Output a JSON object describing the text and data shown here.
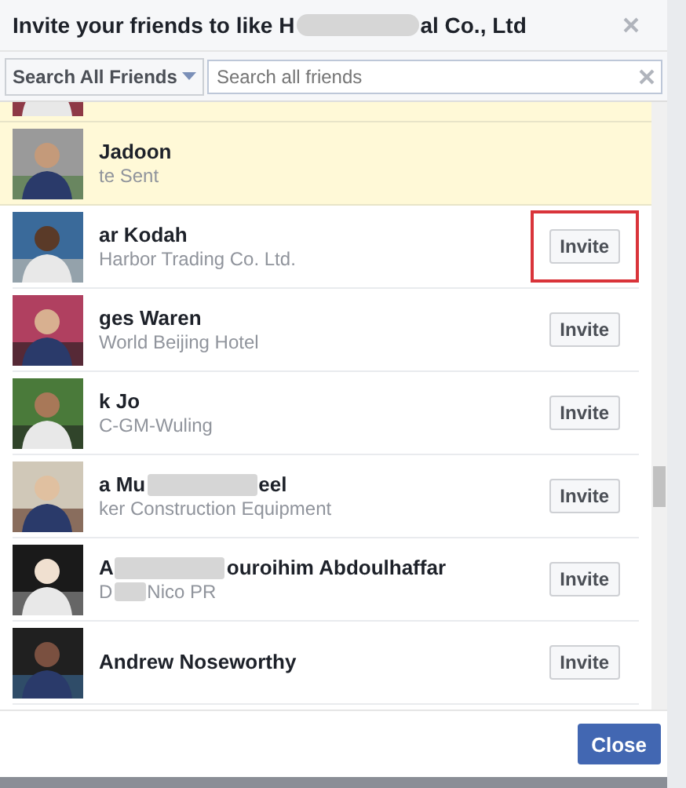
{
  "dialog": {
    "title_parts": [
      "Invite your friends to like H",
      "al Co., Ltd"
    ]
  },
  "search": {
    "scope": "Search All Friends",
    "placeholder": "Search all friends"
  },
  "friends": [
    {
      "invited": true,
      "kind": "picture"
    },
    {
      "name_parts": [
        "Jadoon"
      ],
      "sub_parts": [
        "te Sent"
      ],
      "invited": true,
      "kind": "picture"
    },
    {
      "name_parts": [
        "ar Kodah"
      ],
      "sub_parts": [
        "Harbor Trading Co. Ltd."
      ],
      "invited": false,
      "highlighted": true,
      "action": "Invite",
      "kind": "picture"
    },
    {
      "name_parts": [
        "ges Waren"
      ],
      "sub_parts": [
        "World Beijing Hotel"
      ],
      "invited": false,
      "highlighted": false,
      "action": "Invite",
      "kind": "picture"
    },
    {
      "name_parts": [
        "k Jo"
      ],
      "sub_parts": [
        "C-GM-Wuling"
      ],
      "invited": false,
      "highlighted": false,
      "action": "Invite",
      "kind": "picture"
    },
    {
      "name_parts": [
        "a Mu",
        "eel"
      ],
      "sub_parts": [
        "ker Construction Equipment"
      ],
      "invited": false,
      "highlighted": false,
      "action": "Invite",
      "kind": "picture"
    },
    {
      "name_parts": [
        "A",
        "ouroihim Abdoulhaffar"
      ],
      "sub_parts": [
        "D",
        "Nico PR"
      ],
      "invited": false,
      "highlighted": false,
      "action": "Invite",
      "kind": "picture"
    },
    {
      "name_parts": [
        "Andrew Noseworthy"
      ],
      "invited": false,
      "highlighted": false,
      "action": "Invite",
      "kind": "picture"
    }
  ],
  "footer": {
    "close": "Close"
  }
}
